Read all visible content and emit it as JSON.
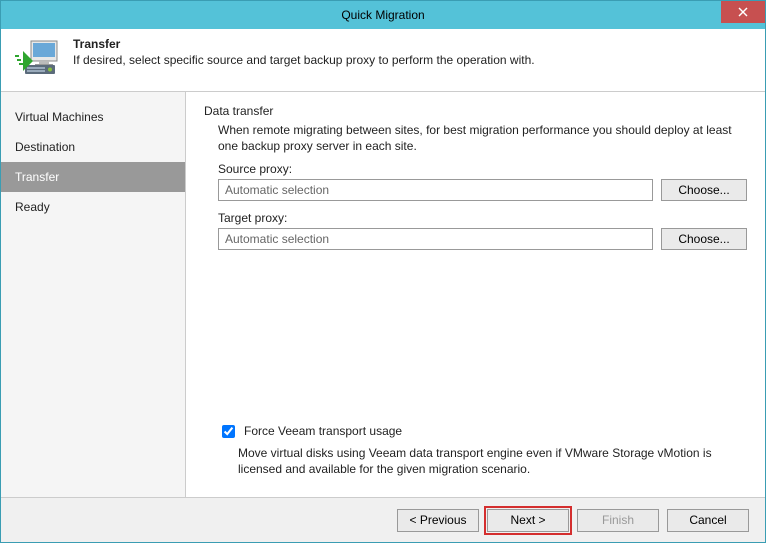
{
  "window": {
    "title": "Quick Migration"
  },
  "header": {
    "title": "Transfer",
    "description": "If desired, select specific source and target backup proxy to perform the operation with."
  },
  "sidebar": {
    "items": [
      {
        "label": "Virtual Machines"
      },
      {
        "label": "Destination"
      },
      {
        "label": "Transfer"
      },
      {
        "label": "Ready"
      }
    ],
    "active_index": 2
  },
  "content": {
    "section_title": "Data transfer",
    "section_desc": "When remote migrating between sites, for best migration performance you should deploy at least one backup proxy server in each site.",
    "source_proxy_label": "Source proxy:",
    "source_proxy_value": "Automatic selection",
    "source_proxy_choose": "Choose...",
    "target_proxy_label": "Target proxy:",
    "target_proxy_value": "Automatic selection",
    "target_proxy_choose": "Choose...",
    "force_checkbox_label": "Force Veeam transport usage",
    "force_checkbox_checked": true,
    "force_desc": "Move virtual disks using Veeam data transport engine even if VMware Storage vMotion is licensed and available for the given migration scenario."
  },
  "footer": {
    "previous": "< Previous",
    "next": "Next >",
    "finish": "Finish",
    "cancel": "Cancel"
  }
}
